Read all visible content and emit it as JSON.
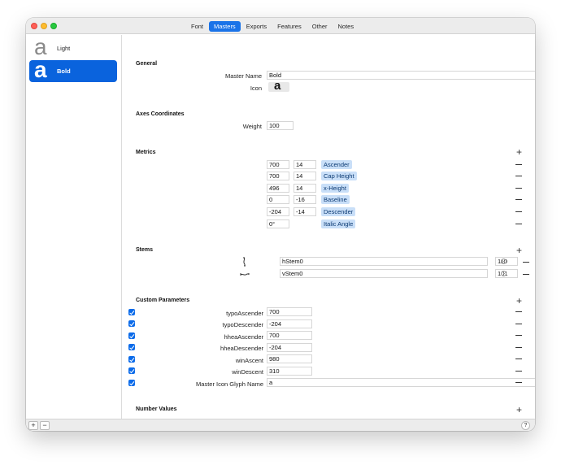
{
  "tabs": [
    "Font",
    "Masters",
    "Exports",
    "Features",
    "Other",
    "Notes"
  ],
  "active_tab": "Masters",
  "sidebar": {
    "masters": [
      {
        "name": "Light",
        "glyph": "a",
        "selected": false
      },
      {
        "name": "Bold",
        "glyph": "a",
        "selected": true
      }
    ],
    "add_label": "+",
    "remove_label": "−"
  },
  "help_label": "?",
  "general": {
    "title": "General",
    "master_name_label": "Master Name",
    "master_name": "Bold",
    "icon_label": "Icon",
    "icon_glyph": "a"
  },
  "axes": {
    "title": "Axes Coordinates",
    "weight_label": "Weight",
    "weight": "100"
  },
  "metrics": {
    "title": "Metrics",
    "rows": [
      {
        "value": "700",
        "overshoot": "14",
        "name": "Ascender"
      },
      {
        "value": "700",
        "overshoot": "14",
        "name": "Cap Height"
      },
      {
        "value": "496",
        "overshoot": "14",
        "name": "x-Height"
      },
      {
        "value": "0",
        "overshoot": "-16",
        "name": "Baseline"
      },
      {
        "value": "-204",
        "overshoot": "-14",
        "name": "Descender"
      },
      {
        "value": "0°",
        "overshoot": "",
        "name": "Italic Angle"
      }
    ]
  },
  "stems": {
    "title": "Stems",
    "rows": [
      {
        "icon": "horizontal-stem-icon",
        "name": "hStem0",
        "value": "110"
      },
      {
        "icon": "vertical-stem-icon",
        "name": "vStem0",
        "value": "101"
      }
    ]
  },
  "custom_parameters": {
    "title": "Custom Parameters",
    "rows": [
      {
        "name": "typoAscender",
        "value": "700",
        "checked": true
      },
      {
        "name": "typoDescender",
        "value": "-204",
        "checked": true
      },
      {
        "name": "hheaAscender",
        "value": "700",
        "checked": true
      },
      {
        "name": "hheaDescender",
        "value": "-204",
        "checked": true
      },
      {
        "name": "winAscent",
        "value": "980",
        "checked": true
      },
      {
        "name": "winDescent",
        "value": "310",
        "checked": true
      },
      {
        "name": "Master Icon Glyph Name",
        "value": "a",
        "checked": true
      }
    ]
  },
  "number_values": {
    "title": "Number Values"
  },
  "colors": {
    "accent": "#1a73e8",
    "selection": "#0a63dd",
    "chip_bg": "#c9dff8"
  }
}
